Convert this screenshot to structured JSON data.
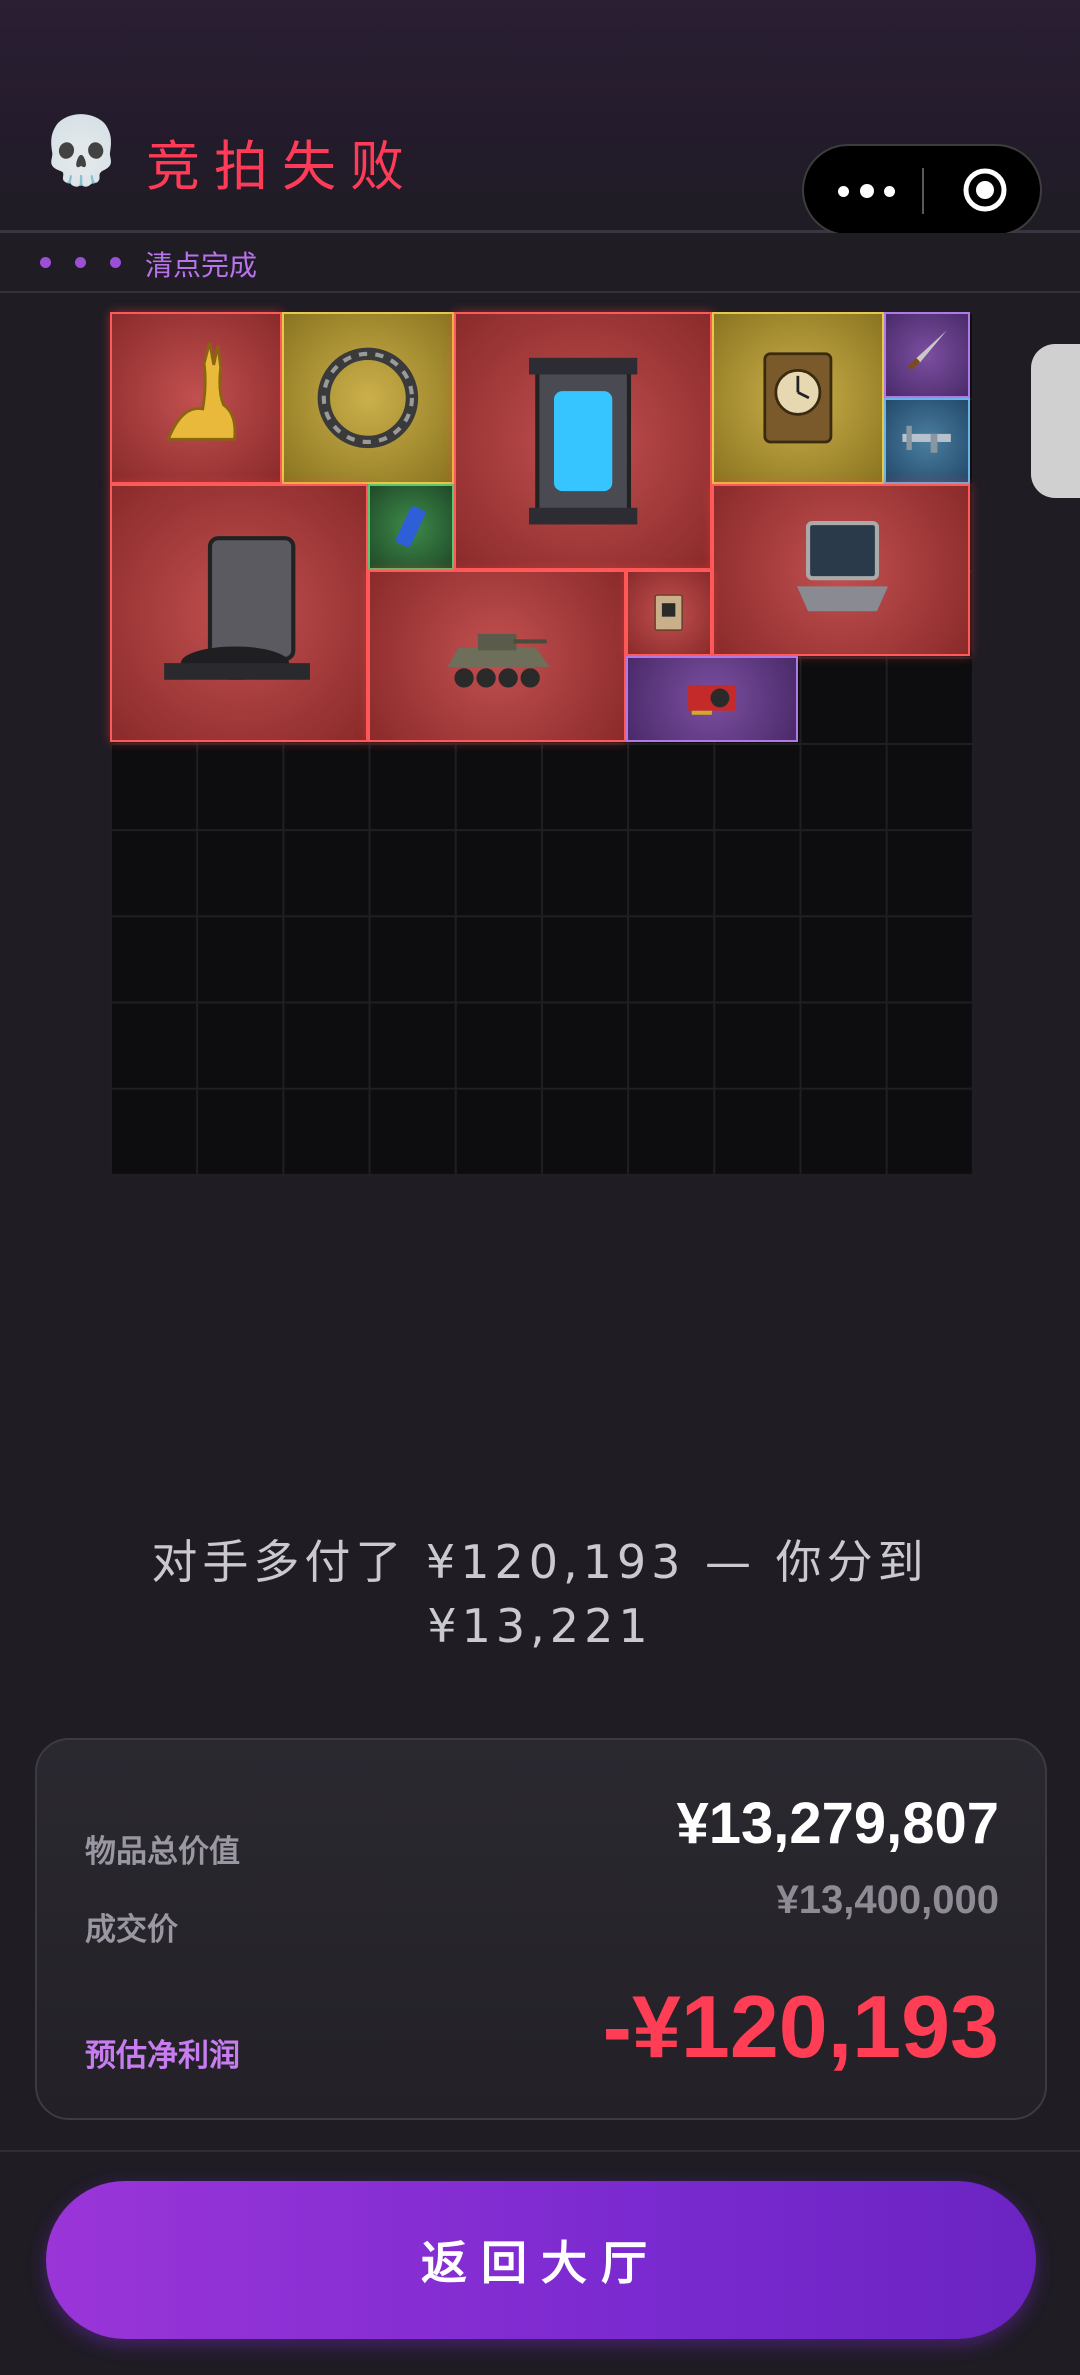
{
  "header": {
    "icon": "skull-icon",
    "title": "竞拍失败"
  },
  "capsule": {
    "more_icon": "more-dots-icon",
    "close_icon": "target-circle-icon"
  },
  "progress": {
    "status": "清点完成",
    "dots": 3
  },
  "inventory": {
    "items": [
      {
        "name": "gold-antelope-statue",
        "rarity": "red"
      },
      {
        "name": "mechanical-ring-device",
        "rarity": "gold"
      },
      {
        "name": "energy-reactor-core",
        "rarity": "red"
      },
      {
        "name": "antique-clock",
        "rarity": "gold"
      },
      {
        "name": "dagger",
        "rarity": "purple"
      },
      {
        "name": "caliper",
        "rarity": "blue"
      },
      {
        "name": "robot-vacuum-station",
        "rarity": "red"
      },
      {
        "name": "energy-drink-can",
        "rarity": "green"
      },
      {
        "name": "rugged-laptop",
        "rarity": "red"
      },
      {
        "name": "armored-vehicle",
        "rarity": "red"
      },
      {
        "name": "circuit-module",
        "rarity": "red"
      },
      {
        "name": "graphics-card",
        "rarity": "purple"
      }
    ]
  },
  "message": {
    "line1": "对手多付了 ¥120,193 — 你分到",
    "line2": "¥13,221"
  },
  "summary": {
    "total_label": "物品总价值",
    "total_value": "¥13,279,807",
    "deal_label": "成交价",
    "deal_value": "¥13,400,000",
    "profit_label": "预估净利润",
    "profit_value": "-¥120,193"
  },
  "actions": {
    "return_label": "返回大厅"
  },
  "colors": {
    "accent": "#8f31d6",
    "loss": "#ff3d55",
    "title": "#ff3b57",
    "status": "#b873ea"
  }
}
